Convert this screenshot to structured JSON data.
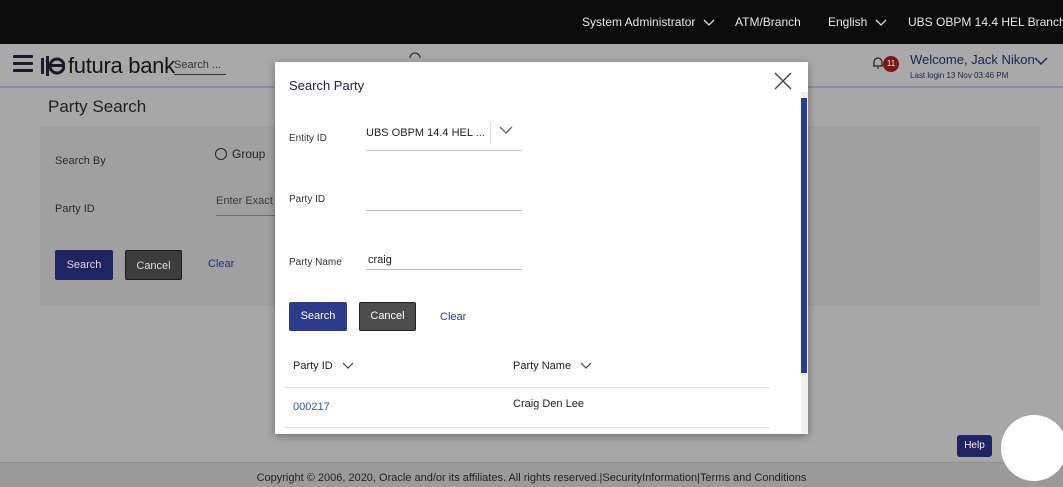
{
  "topbar": {
    "role": "System Administrator",
    "location": "ATM/Branch",
    "language": "English",
    "entity": "UBS OBPM 14.4 HEL Branch"
  },
  "header": {
    "brand": "futura bank",
    "search_placeholder": "Search ...",
    "notification_count": "11",
    "welcome": "Welcome, Jack Nikon",
    "last_login": "Last login 13 Nov 03:46 PM"
  },
  "page": {
    "title": "Party Search",
    "search_by_label": "Search By",
    "group_option": "Group",
    "party_id_label": "Party ID",
    "party_id_placeholder": "Enter Exact",
    "search_label": "Search",
    "cancel_label": "Cancel",
    "clear_label": "Clear"
  },
  "modal": {
    "title": "Search Party",
    "entity_id_label": "Entity ID",
    "entity_id_value": "UBS OBPM 14.4 HEL ...",
    "party_id_label": "Party ID",
    "party_id_value": "",
    "party_name_label": "Party Name",
    "party_name_value": "craig",
    "search_label": "Search",
    "cancel_label": "Cancel",
    "clear_label": "Clear",
    "columns": [
      "Party ID",
      "Party Name"
    ],
    "rows": [
      {
        "party_id": "000217",
        "party_name": "Craig Den Lee"
      }
    ]
  },
  "footer": {
    "text": "Copyright © 2006, 2020, Oracle and/or its affiliates. All rights reserved.|SecurityInformation|Terms and Conditions",
    "help_label": "Help"
  },
  "colors": {
    "primary": "#2d3a8c",
    "link": "#2b58b8",
    "overlay_bg": "#a7a7a7",
    "topbar": "#0b0b0b"
  }
}
